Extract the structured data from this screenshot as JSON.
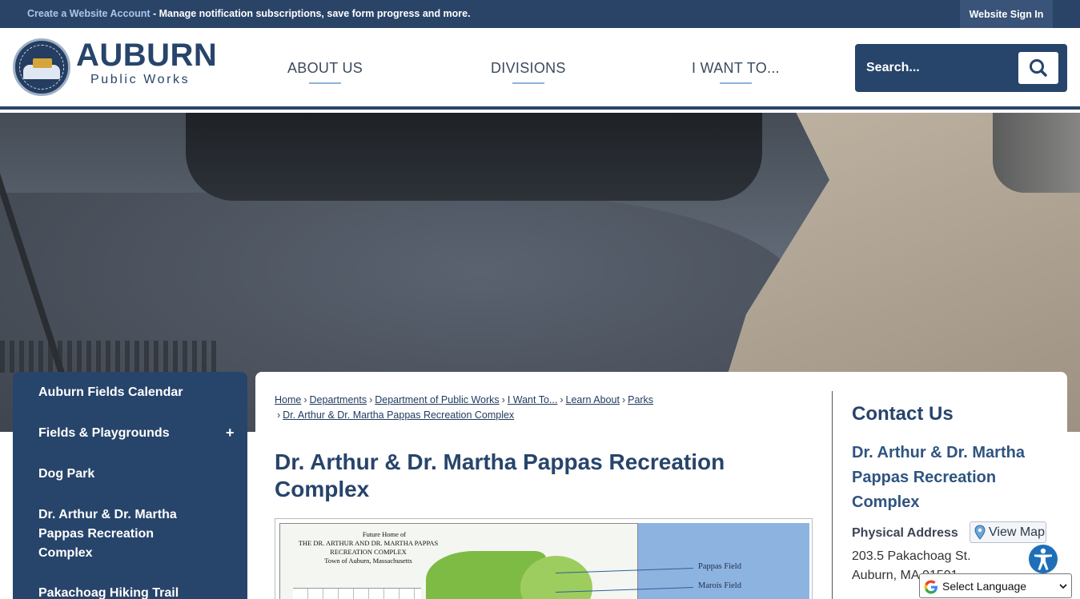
{
  "topbar": {
    "create_account_link": "Create a Website Account",
    "message": " - Manage notification subscriptions, save form progress and more.",
    "sign_in": "Website Sign In"
  },
  "brand": {
    "title": "AUBURN",
    "subtitle": "Public Works",
    "seal_text": "TOWN OF AUBURN"
  },
  "nav": {
    "items": [
      {
        "label": "ABOUT US"
      },
      {
        "label": "DIVISIONS"
      },
      {
        "label": "I WANT TO..."
      }
    ]
  },
  "search": {
    "placeholder": "Search...",
    "icon": "search-icon"
  },
  "sidebar": {
    "items": [
      {
        "label": "Auburn Fields Calendar"
      },
      {
        "label": "Fields & Playgrounds",
        "expand": "+"
      },
      {
        "label": "Dog Park"
      },
      {
        "label": "Dr. Arthur & Dr. Martha Pappas Recreation Complex"
      },
      {
        "label": "Pakachoag Hiking Trail"
      }
    ]
  },
  "breadcrumb": {
    "separator": "›",
    "items": [
      {
        "label": "Home"
      },
      {
        "label": "Departments"
      },
      {
        "label": "Department of Public Works"
      },
      {
        "label": "I Want To..."
      },
      {
        "label": "Learn About"
      },
      {
        "label": "Parks"
      },
      {
        "label": "Dr. Arthur & Dr. Martha Pappas Recreation Complex"
      }
    ]
  },
  "main": {
    "title": "Dr. Arthur & Dr. Martha Pappas Recreation Complex",
    "map_image": {
      "heading_line1": "Future Home of",
      "heading_line2": "THE DR. ARTHUR AND DR. MARTHA PAPPAS",
      "heading_line3": "RECREATION COMPLEX",
      "heading_line4": "Town of Auburn, Massachusetts",
      "labels": [
        "Pappas Field",
        "Marois Field"
      ]
    }
  },
  "contact": {
    "heading": "Contact Us",
    "name": "Dr. Arthur & Dr. Martha Pappas Recreation Complex",
    "address_label": "Physical Address",
    "view_map": "View Map",
    "address_line1": "203.5 Pakachoag St.",
    "address_line2": "Auburn, MA 01501"
  },
  "language": {
    "label": "Select Language"
  },
  "colors": {
    "primary": "#27446b",
    "topbar": "#2a4468",
    "link_accent": "#a9c6ec",
    "accessibility": "#1f6fb8"
  }
}
